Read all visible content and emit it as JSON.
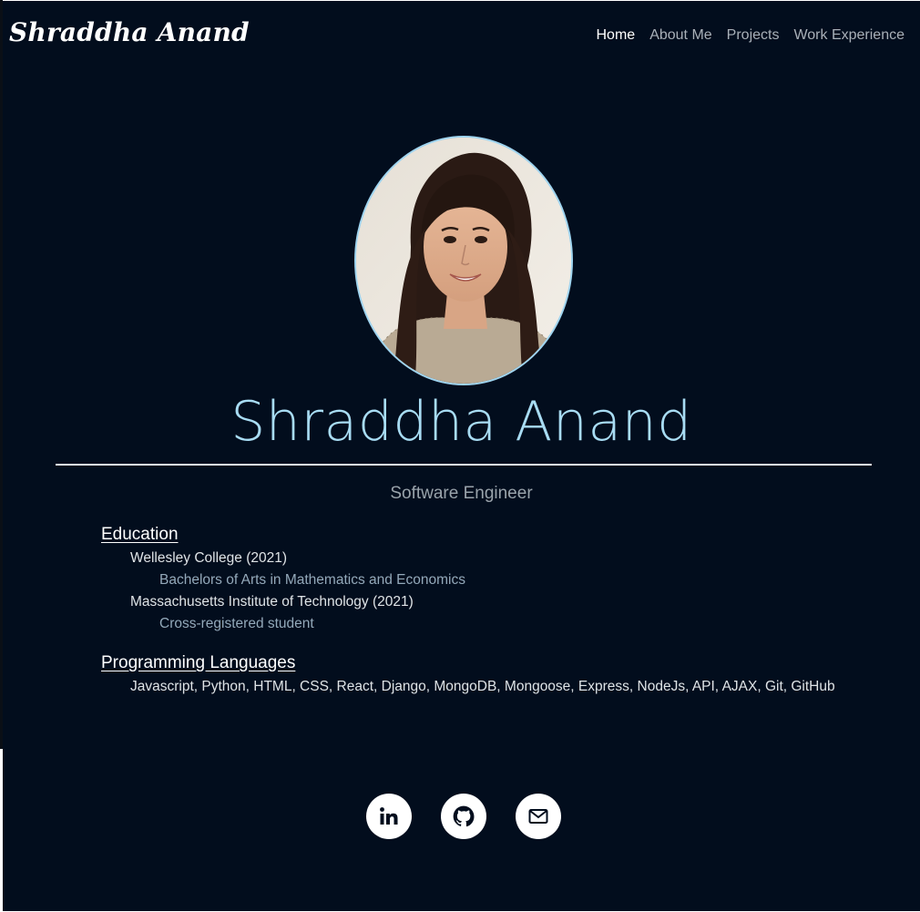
{
  "brand": "Shraddha Anand",
  "nav": {
    "items": [
      "Home",
      "About Me",
      "Projects",
      "Work Experience"
    ],
    "active": "Home"
  },
  "hero": {
    "name": "Shraddha Anand",
    "role": "Software Engineer",
    "photo_alt": "Portrait photo"
  },
  "education": {
    "title": "Education",
    "schools": [
      {
        "name": "Wellesley College (2021)",
        "detail": "Bachelors of Arts in Mathematics and Economics"
      },
      {
        "name": "Massachusetts Institute of Technology (2021)",
        "detail": "Cross-registered student"
      }
    ]
  },
  "languages": {
    "title": "Programming Languages",
    "list": "Javascript, Python, HTML, CSS, React, Django, MongoDB, Mongoose, Express, NodeJs, API, AJAX, Git, GitHub"
  },
  "social": [
    "linkedin-icon",
    "github-icon",
    "mail-icon"
  ],
  "colors": {
    "background": "#020d1d",
    "accent": "#a8dcf3",
    "text": "#ffffff",
    "muted": "#9aa3ab"
  }
}
